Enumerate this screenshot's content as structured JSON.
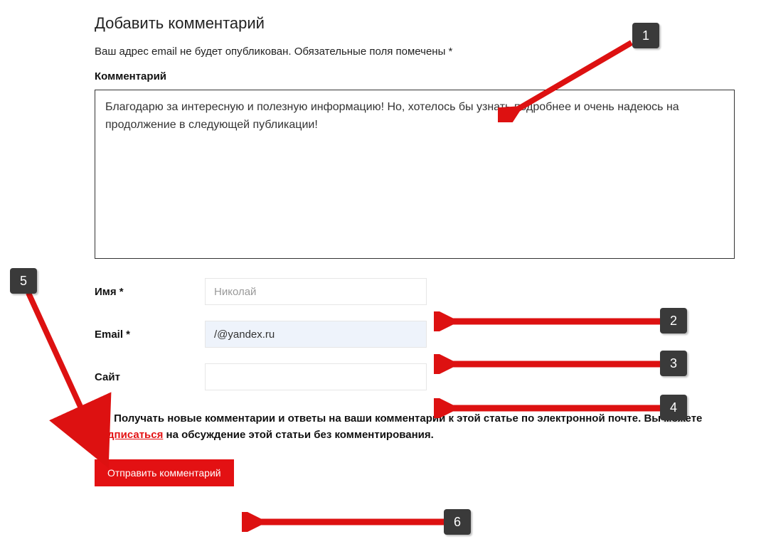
{
  "form": {
    "title": "Добавить комментарий",
    "note": "Ваш адрес email не будет опубликован. Обязательные поля помечены *",
    "comment_label": "Комментарий",
    "comment_value": "Благодарю за интересную и полезную информацию! Но, хотелось бы узнать подробнее и очень надеюсь на продолжение в следующей публикации!",
    "name_label": "Имя *",
    "name_value": "Николай",
    "email_label": "Email *",
    "email_value": "/@yandex.ru",
    "site_label": "Сайт",
    "site_value": "",
    "notify_prefix": "Получать новые комментарии и ответы на ваши комментарии к этой статье по электронной почте. Вы можете ",
    "notify_link": "подписаться",
    "notify_suffix": " на обсуждение этой статьи без комментирования.",
    "notify_checked": true,
    "submit_label": "Отправить комментарий"
  },
  "annotations": {
    "b1": "1",
    "b2": "2",
    "b3": "3",
    "b4": "4",
    "b5": "5",
    "b6": "6"
  }
}
